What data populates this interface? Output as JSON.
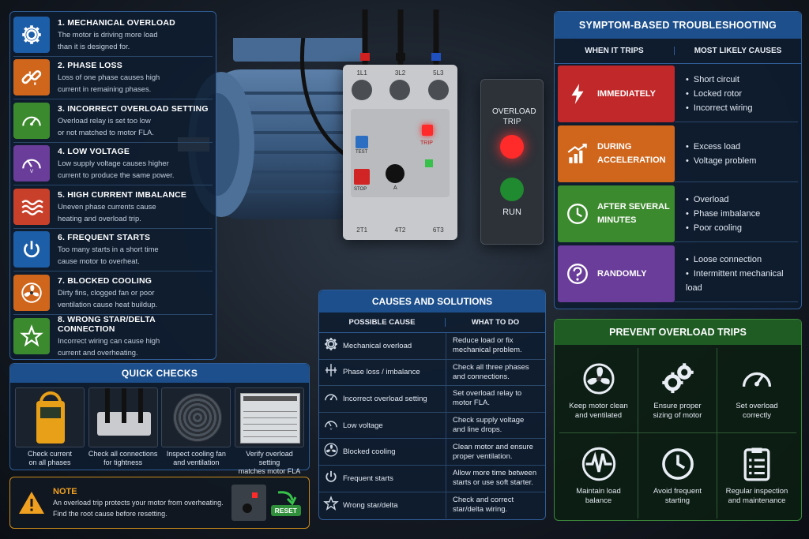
{
  "causes": [
    {
      "title": "1. MECHANICAL OVERLOAD",
      "desc1": "The motor is driving more load",
      "desc2": "than it is designed for.",
      "color": "#1d5ea8",
      "icon": "gear-icon"
    },
    {
      "title": "2. PHASE LOSS",
      "desc1": "Loss of one phase causes high",
      "desc2": "current in remaining phases.",
      "color": "#d0661c",
      "icon": "broken-chain-icon"
    },
    {
      "title": "3. INCORRECT OVERLOAD SETTING",
      "desc1": "Overload relay is set too low",
      "desc2": "or not matched to motor FLA.",
      "color": "#3c8a2e",
      "icon": "gauge-icon"
    },
    {
      "title": "4. LOW VOLTAGE",
      "desc1": "Low supply voltage causes higher",
      "desc2": "current to produce the same power.",
      "color": "#6a3d9a",
      "icon": "voltmeter-icon"
    },
    {
      "title": "5. HIGH CURRENT IMBALANCE",
      "desc1": "Uneven phase currents cause",
      "desc2": "heating and overload trip.",
      "color": "#c8402a",
      "icon": "waves-icon"
    },
    {
      "title": "6. FREQUENT STARTS",
      "desc1": "Too many starts in a short time",
      "desc2": "cause motor to overheat.",
      "color": "#1d5ea8",
      "icon": "power-icon"
    },
    {
      "title": "7. BLOCKED COOLING",
      "desc1": "Dirty fins, clogged fan or poor",
      "desc2": "ventilation cause heat buildup.",
      "color": "#d0661c",
      "icon": "fan-icon"
    },
    {
      "title": "8. WRONG STAR/DELTA CONNECTION",
      "desc1": "Incorrect wiring can cause high",
      "desc2": "current and overheating.",
      "color": "#3c8a2e",
      "icon": "star-icon"
    }
  ],
  "quick_checks": {
    "title": "QUICK CHECKS",
    "items": [
      {
        "line1": "Check current",
        "line2": "on all phases"
      },
      {
        "line1": "Check all connections",
        "line2": "for tightness"
      },
      {
        "line1": "Inspect cooling fan",
        "line2": "and ventilation"
      },
      {
        "line1": "Verify overload setting",
        "line2": "matches motor FLA"
      }
    ]
  },
  "note": {
    "title": "NOTE",
    "line1": "An overload trip protects your motor from overheating.",
    "line2": "Find the root cause before resetting.",
    "reset": "RESET"
  },
  "device": {
    "terminals_top": [
      "1L1",
      "3L2",
      "5L3"
    ],
    "terminals_bottom": [
      "2T1",
      "4T2",
      "6T3"
    ],
    "test": "TEST",
    "stop": "STOP",
    "trip": "TRIP",
    "dial": "A",
    "overload_trip": "OVERLOAD TRIP",
    "run": "RUN"
  },
  "symptom": {
    "title": "SYMPTOM-BASED TROUBLESHOOTING",
    "col1": "WHEN IT TRIPS",
    "col2": "MOST LIKELY CAUSES",
    "rows": [
      {
        "when1": "IMMEDIATELY",
        "when2": "",
        "color": "#c0282a",
        "icon": "lightning-icon",
        "causes": [
          "Short circuit",
          "Locked rotor",
          "Incorrect wiring"
        ]
      },
      {
        "when1": "DURING",
        "when2": "ACCELERATION",
        "color": "#d0661c",
        "icon": "rising-chart-icon",
        "causes": [
          "Excess load",
          "Voltage problem"
        ]
      },
      {
        "when1": "AFTER SEVERAL",
        "when2": "MINUTES",
        "color": "#3c8a2e",
        "icon": "clock-icon",
        "causes": [
          "Overload",
          "Phase imbalance",
          "Poor cooling"
        ]
      },
      {
        "when1": "RANDOMLY",
        "when2": "",
        "color": "#6a3d9a",
        "icon": "question-icon",
        "causes": [
          "Loose connection",
          "Intermittent mechanical load"
        ]
      }
    ]
  },
  "solutions": {
    "title": "CAUSES AND SOLUTIONS",
    "col1": "POSSIBLE CAUSE",
    "col2": "WHAT TO DO",
    "rows": [
      {
        "cause": "Mechanical overload",
        "fix1": "Reduce load or fix",
        "fix2": "mechanical problem.",
        "icon": "gear-icon"
      },
      {
        "cause": "Phase loss / imbalance",
        "fix1": "Check all three phases",
        "fix2": "and connections.",
        "icon": "phase-icon"
      },
      {
        "cause": "Incorrect overload setting",
        "fix1": "Set overload relay to",
        "fix2": "motor FLA.",
        "icon": "gauge-icon"
      },
      {
        "cause": "Low voltage",
        "fix1": "Check supply voltage",
        "fix2": "and line drops.",
        "icon": "voltmeter-icon"
      },
      {
        "cause": "Blocked cooling",
        "fix1": "Clean motor and ensure",
        "fix2": "proper ventilation.",
        "icon": "fan-icon"
      },
      {
        "cause": "Frequent starts",
        "fix1": "Allow more time between",
        "fix2": "starts or use soft starter.",
        "icon": "power-icon"
      },
      {
        "cause": "Wrong star/delta",
        "fix1": "Check and correct",
        "fix2": "star/delta wiring.",
        "icon": "star-icon"
      }
    ]
  },
  "prevent": {
    "title": "PREVENT OVERLOAD TRIPS",
    "items": [
      {
        "line1": "Keep motor clean",
        "line2": "and ventilated",
        "icon": "fan-icon"
      },
      {
        "line1": "Ensure proper",
        "line2": "sizing of motor",
        "icon": "gears-icon"
      },
      {
        "line1": "Set overload",
        "line2": "correctly",
        "icon": "gauge-icon"
      },
      {
        "line1": "Maintain load",
        "line2": "balance",
        "icon": "waveform-icon"
      },
      {
        "line1": "Avoid frequent",
        "line2": "starting",
        "icon": "clock-icon"
      },
      {
        "line1": "Regular inspection",
        "line2": "and maintenance",
        "icon": "checklist-icon"
      }
    ]
  }
}
